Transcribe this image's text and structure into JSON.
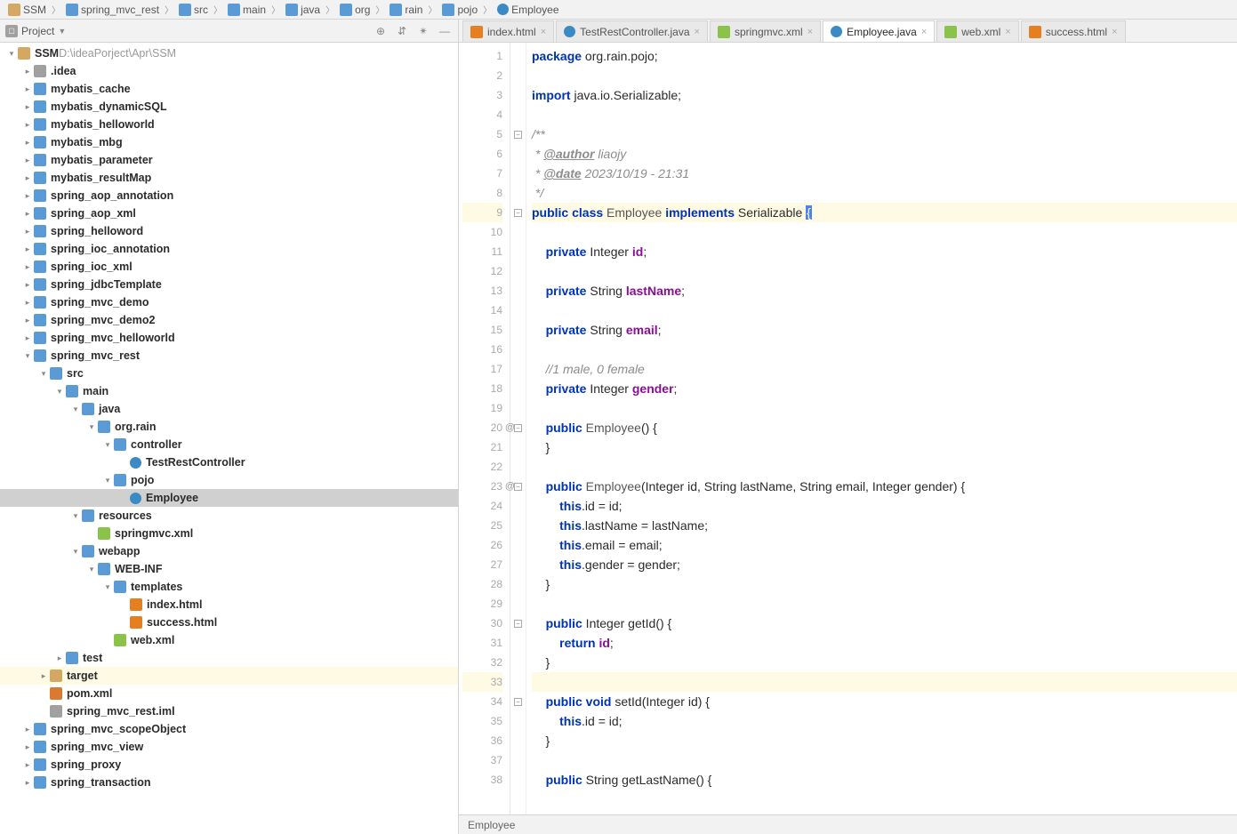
{
  "breadcrumb": [
    {
      "icon": "folder",
      "label": "SSM"
    },
    {
      "icon": "blue",
      "label": "spring_mvc_rest"
    },
    {
      "icon": "blue",
      "label": "src"
    },
    {
      "icon": "blue",
      "label": "main"
    },
    {
      "icon": "blue",
      "label": "java"
    },
    {
      "icon": "blue",
      "label": "org"
    },
    {
      "icon": "blue",
      "label": "rain"
    },
    {
      "icon": "blue",
      "label": "pojo"
    },
    {
      "icon": "class",
      "label": "Employee"
    }
  ],
  "sidebar": {
    "title": "Project",
    "root": {
      "name": "SSM",
      "path": "D:\\ideaPorject\\Apr\\SSM"
    }
  },
  "tree": [
    {
      "d": 0,
      "arrow": "v",
      "icon": "folder",
      "label": "SSM",
      "suffix": "D:\\ideaPorject\\Apr\\SSM"
    },
    {
      "d": 1,
      "arrow": ">",
      "icon": "gray",
      "label": ".idea"
    },
    {
      "d": 1,
      "arrow": ">",
      "icon": "blue",
      "label": "mybatis_cache"
    },
    {
      "d": 1,
      "arrow": ">",
      "icon": "blue",
      "label": "mybatis_dynamicSQL"
    },
    {
      "d": 1,
      "arrow": ">",
      "icon": "blue",
      "label": "mybatis_helloworld"
    },
    {
      "d": 1,
      "arrow": ">",
      "icon": "blue",
      "label": "mybatis_mbg"
    },
    {
      "d": 1,
      "arrow": ">",
      "icon": "blue",
      "label": "mybatis_parameter"
    },
    {
      "d": 1,
      "arrow": ">",
      "icon": "blue",
      "label": "mybatis_resultMap"
    },
    {
      "d": 1,
      "arrow": ">",
      "icon": "blue",
      "label": "spring_aop_annotation"
    },
    {
      "d": 1,
      "arrow": ">",
      "icon": "blue",
      "label": "spring_aop_xml"
    },
    {
      "d": 1,
      "arrow": ">",
      "icon": "blue",
      "label": "spring_helloword"
    },
    {
      "d": 1,
      "arrow": ">",
      "icon": "blue",
      "label": "spring_ioc_annotation"
    },
    {
      "d": 1,
      "arrow": ">",
      "icon": "blue",
      "label": "spring_ioc_xml"
    },
    {
      "d": 1,
      "arrow": ">",
      "icon": "blue",
      "label": "spring_jdbcTemplate"
    },
    {
      "d": 1,
      "arrow": ">",
      "icon": "blue",
      "label": "spring_mvc_demo"
    },
    {
      "d": 1,
      "arrow": ">",
      "icon": "blue",
      "label": "spring_mvc_demo2"
    },
    {
      "d": 1,
      "arrow": ">",
      "icon": "blue",
      "label": "spring_mvc_helloworld"
    },
    {
      "d": 1,
      "arrow": "v",
      "icon": "blue",
      "label": "spring_mvc_rest"
    },
    {
      "d": 2,
      "arrow": "v",
      "icon": "blue",
      "label": "src"
    },
    {
      "d": 3,
      "arrow": "v",
      "icon": "blue",
      "label": "main"
    },
    {
      "d": 4,
      "arrow": "v",
      "icon": "blue",
      "label": "java"
    },
    {
      "d": 5,
      "arrow": "v",
      "icon": "blue",
      "label": "org.rain"
    },
    {
      "d": 6,
      "arrow": "v",
      "icon": "blue",
      "label": "controller"
    },
    {
      "d": 7,
      "arrow": "",
      "icon": "class",
      "label": "TestRestController"
    },
    {
      "d": 6,
      "arrow": "v",
      "icon": "blue",
      "label": "pojo"
    },
    {
      "d": 7,
      "arrow": "",
      "icon": "class",
      "label": "Employee",
      "selected": true
    },
    {
      "d": 4,
      "arrow": "v",
      "icon": "blue",
      "label": "resources"
    },
    {
      "d": 5,
      "arrow": "",
      "icon": "xml",
      "label": "springmvc.xml"
    },
    {
      "d": 4,
      "arrow": "v",
      "icon": "blue",
      "label": "webapp"
    },
    {
      "d": 5,
      "arrow": "v",
      "icon": "blue",
      "label": "WEB-INF"
    },
    {
      "d": 6,
      "arrow": "v",
      "icon": "blue",
      "label": "templates"
    },
    {
      "d": 7,
      "arrow": "",
      "icon": "html",
      "label": "index.html"
    },
    {
      "d": 7,
      "arrow": "",
      "icon": "html",
      "label": "success.html"
    },
    {
      "d": 6,
      "arrow": "",
      "icon": "xml",
      "label": "web.xml"
    },
    {
      "d": 3,
      "arrow": ">",
      "icon": "blue",
      "label": "test"
    },
    {
      "d": 2,
      "arrow": ">",
      "icon": "folder",
      "label": "target",
      "highlight": true
    },
    {
      "d": 2,
      "arrow": "",
      "icon": "maven",
      "label": "pom.xml"
    },
    {
      "d": 2,
      "arrow": "",
      "icon": "gray",
      "label": "spring_mvc_rest.iml"
    },
    {
      "d": 1,
      "arrow": ">",
      "icon": "blue",
      "label": "spring_mvc_scopeObject"
    },
    {
      "d": 1,
      "arrow": ">",
      "icon": "blue",
      "label": "spring_mvc_view"
    },
    {
      "d": 1,
      "arrow": ">",
      "icon": "blue",
      "label": "spring_proxy"
    },
    {
      "d": 1,
      "arrow": ">",
      "icon": "blue",
      "label": "spring_transaction"
    }
  ],
  "tabs": [
    {
      "icon": "html",
      "label": "index.html"
    },
    {
      "icon": "class",
      "label": "TestRestController.java"
    },
    {
      "icon": "xml",
      "label": "springmvc.xml"
    },
    {
      "icon": "class",
      "label": "Employee.java",
      "active": true
    },
    {
      "icon": "xml",
      "label": "web.xml"
    },
    {
      "icon": "html",
      "label": "success.html"
    }
  ],
  "code": {
    "lines": [
      {
        "n": 1,
        "t": [
          [
            "kw",
            "package"
          ],
          [
            "",
            " org.rain.pojo;"
          ]
        ]
      },
      {
        "n": 2,
        "t": [
          [
            "",
            ""
          ]
        ]
      },
      {
        "n": 3,
        "t": [
          [
            "kw",
            "import"
          ],
          [
            "",
            " java.io.Serializable;"
          ]
        ]
      },
      {
        "n": 4,
        "t": [
          [
            "",
            ""
          ]
        ]
      },
      {
        "n": 5,
        "fold": "-",
        "t": [
          [
            "doc",
            "/**"
          ]
        ]
      },
      {
        "n": 6,
        "t": [
          [
            "doc",
            " * "
          ],
          [
            "doctag",
            "@author"
          ],
          [
            "doc",
            " liaojy"
          ]
        ]
      },
      {
        "n": 7,
        "t": [
          [
            "doc",
            " * "
          ],
          [
            "doctag",
            "@date"
          ],
          [
            "doc",
            " 2023/10/19 - 21:31"
          ]
        ]
      },
      {
        "n": 8,
        "fold": "e",
        "t": [
          [
            "doc",
            " */"
          ]
        ]
      },
      {
        "n": 9,
        "hl": true,
        "fold": "-",
        "t": [
          [
            "kw",
            "public class"
          ],
          [
            "cls",
            " Employee "
          ],
          [
            "kw",
            "implements"
          ],
          [
            "",
            " Serializable "
          ],
          [
            "cursor",
            "{"
          ]
        ]
      },
      {
        "n": 10,
        "t": [
          [
            "",
            ""
          ]
        ]
      },
      {
        "n": 11,
        "t": [
          [
            "",
            "    "
          ],
          [
            "kw",
            "private"
          ],
          [
            "",
            " Integer "
          ],
          [
            "fld",
            "id"
          ],
          [
            "",
            ";"
          ]
        ]
      },
      {
        "n": 12,
        "t": [
          [
            "",
            ""
          ]
        ]
      },
      {
        "n": 13,
        "t": [
          [
            "",
            "    "
          ],
          [
            "kw",
            "private"
          ],
          [
            "",
            " String "
          ],
          [
            "fld",
            "lastName"
          ],
          [
            "",
            ";"
          ]
        ]
      },
      {
        "n": 14,
        "t": [
          [
            "",
            ""
          ]
        ]
      },
      {
        "n": 15,
        "t": [
          [
            "",
            "    "
          ],
          [
            "kw",
            "private"
          ],
          [
            "",
            " String "
          ],
          [
            "fld",
            "email"
          ],
          [
            "",
            ";"
          ]
        ]
      },
      {
        "n": 16,
        "t": [
          [
            "",
            ""
          ]
        ]
      },
      {
        "n": 17,
        "t": [
          [
            "",
            "    "
          ],
          [
            "cmt",
            "//1 male, 0 female"
          ]
        ]
      },
      {
        "n": 18,
        "t": [
          [
            "",
            "    "
          ],
          [
            "kw",
            "private"
          ],
          [
            "",
            " Integer "
          ],
          [
            "fld",
            "gender"
          ],
          [
            "",
            ";"
          ]
        ]
      },
      {
        "n": 19,
        "t": [
          [
            "",
            ""
          ]
        ]
      },
      {
        "n": 20,
        "ann": "@",
        "fold": "-",
        "t": [
          [
            "",
            "    "
          ],
          [
            "kw",
            "public"
          ],
          [
            "cls",
            " Employee"
          ],
          [
            "",
            "() {"
          ]
        ]
      },
      {
        "n": 21,
        "fold": "e",
        "t": [
          [
            "",
            "    }"
          ]
        ]
      },
      {
        "n": 22,
        "t": [
          [
            "",
            ""
          ]
        ]
      },
      {
        "n": 23,
        "ann": "@",
        "fold": "-",
        "t": [
          [
            "",
            "    "
          ],
          [
            "kw",
            "public"
          ],
          [
            "cls",
            " Employee"
          ],
          [
            "",
            "(Integer id, String lastName, String email, Integer gender) {"
          ]
        ]
      },
      {
        "n": 24,
        "t": [
          [
            "",
            "        "
          ],
          [
            "kw",
            "this"
          ],
          [
            "",
            ".id"
          ],
          [
            "",
            " = id;"
          ]
        ]
      },
      {
        "n": 25,
        "t": [
          [
            "",
            "        "
          ],
          [
            "kw",
            "this"
          ],
          [
            "",
            ".lastName"
          ],
          [
            "",
            " = lastName;"
          ]
        ]
      },
      {
        "n": 26,
        "t": [
          [
            "",
            "        "
          ],
          [
            "kw",
            "this"
          ],
          [
            "",
            ".email"
          ],
          [
            "",
            " = email;"
          ]
        ]
      },
      {
        "n": 27,
        "t": [
          [
            "",
            "        "
          ],
          [
            "kw",
            "this"
          ],
          [
            "",
            ".gender"
          ],
          [
            "",
            " = gender;"
          ]
        ]
      },
      {
        "n": 28,
        "fold": "e",
        "t": [
          [
            "",
            "    }"
          ]
        ]
      },
      {
        "n": 29,
        "t": [
          [
            "",
            ""
          ]
        ]
      },
      {
        "n": 30,
        "fold": "-",
        "t": [
          [
            "",
            "    "
          ],
          [
            "kw",
            "public"
          ],
          [
            "",
            " Integer "
          ],
          [
            "id",
            "getId"
          ],
          [
            "",
            "() {"
          ]
        ]
      },
      {
        "n": 31,
        "t": [
          [
            "",
            "        "
          ],
          [
            "kw",
            "return"
          ],
          [
            "fld",
            " id"
          ],
          [
            "",
            ";"
          ]
        ]
      },
      {
        "n": 32,
        "fold": "e",
        "t": [
          [
            "",
            "    }"
          ]
        ]
      },
      {
        "n": 33,
        "hl": true,
        "t": [
          [
            "",
            ""
          ]
        ]
      },
      {
        "n": 34,
        "fold": "-",
        "t": [
          [
            "",
            "    "
          ],
          [
            "kw",
            "public void"
          ],
          [
            "id",
            " setId"
          ],
          [
            "",
            "(Integer id) {"
          ]
        ]
      },
      {
        "n": 35,
        "t": [
          [
            "",
            "        "
          ],
          [
            "kw",
            "this"
          ],
          [
            "",
            ".id"
          ],
          [
            "",
            " = id;"
          ]
        ]
      },
      {
        "n": 36,
        "fold": "e",
        "t": [
          [
            "",
            "    }"
          ]
        ]
      },
      {
        "n": 37,
        "t": [
          [
            "",
            ""
          ]
        ]
      },
      {
        "n": 38,
        "t": [
          [
            "",
            "    "
          ],
          [
            "kw",
            "public"
          ],
          [
            "",
            " String "
          ],
          [
            "id",
            "getLastName"
          ],
          [
            "",
            "() {"
          ]
        ]
      }
    ]
  },
  "status": "Employee"
}
